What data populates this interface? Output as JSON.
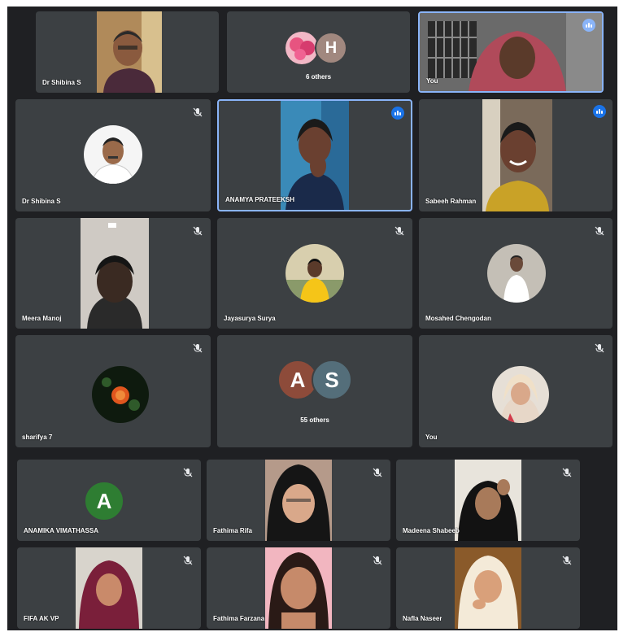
{
  "colors": {
    "background": "#1f2023",
    "tile": "#3c4043",
    "active_border": "#8ab4f8",
    "speaking": "#1a73e8",
    "avatar_a_green": "#2e7d32",
    "avatar_a_brown": "#8d4b3a",
    "avatar_s_slate": "#546e7a",
    "avatar_h_brown": "#a1887f"
  },
  "tiles": {
    "t1": {
      "name": "Dr Shibina S"
    },
    "t2": {
      "others": "6 others",
      "avatars": [
        "",
        "H"
      ]
    },
    "t3": {
      "name": "You",
      "badge": "speaking-icon"
    },
    "t4": {
      "name": "Dr Shibina S"
    },
    "t5": {
      "name": "ANAMYA PRATEEKSH",
      "badge": "speaking-icon"
    },
    "t6": {
      "name": "Sabeeh Rahman",
      "badge": "speaking-icon"
    },
    "t7": {
      "name": "Meera Manoj"
    },
    "t8": {
      "name": "Jayasurya Surya"
    },
    "t9": {
      "name": "Mosahed Chengodan"
    },
    "t10": {
      "name": "sharifya 7"
    },
    "t11": {
      "others": "55 others",
      "avatars": [
        "A",
        "S"
      ]
    },
    "t12": {
      "name": "You"
    },
    "t13": {
      "name": "ANAMIKA VIMATHASSA",
      "avatar": "A"
    },
    "t14": {
      "name": "Fathima Rifa"
    },
    "t15": {
      "name": "Madeena Shabeeb"
    },
    "t16": {
      "name": "FIFA AK VP"
    },
    "t17": {
      "name": "Fathima Farzana"
    },
    "t18": {
      "name": "Nafla Naseer"
    }
  }
}
